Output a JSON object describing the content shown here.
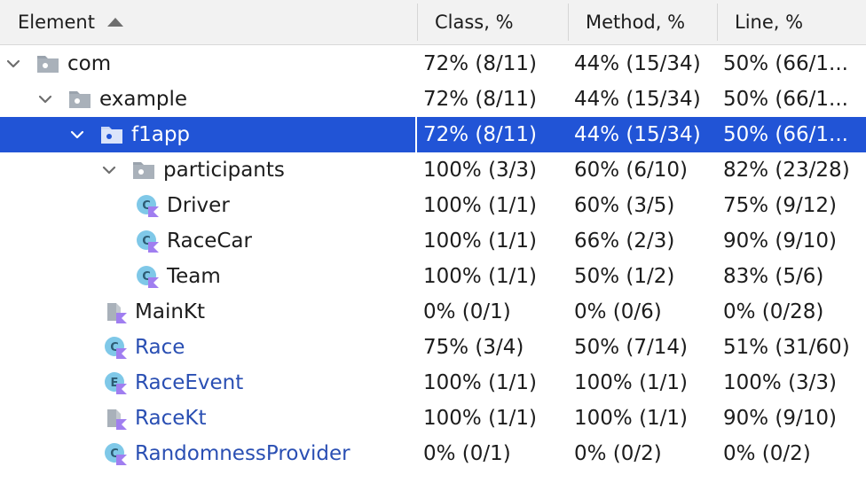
{
  "header": {
    "element": "Element",
    "class_pct": "Class, %",
    "method_pct": "Method, %",
    "line_pct": "Line, %"
  },
  "rows": [
    {
      "name": "com",
      "class": "72% (8/11)",
      "method": "44% (15/34)",
      "line": "50% (66/1...",
      "kind": "package",
      "depth": 0,
      "expanded": true,
      "selected": false,
      "link": false
    },
    {
      "name": "example",
      "class": "72% (8/11)",
      "method": "44% (15/34)",
      "line": "50% (66/1...",
      "kind": "package",
      "depth": 1,
      "expanded": true,
      "selected": false,
      "link": false
    },
    {
      "name": "f1app",
      "class": "72% (8/11)",
      "method": "44% (15/34)",
      "line": "50% (66/1...",
      "kind": "package",
      "depth": 2,
      "expanded": true,
      "selected": true,
      "link": false
    },
    {
      "name": "participants",
      "class": "100% (3/3)",
      "method": "60% (6/10)",
      "line": "82% (23/28)",
      "kind": "package",
      "depth": 3,
      "expanded": true,
      "selected": false,
      "link": false
    },
    {
      "name": "Driver",
      "class": "100% (1/1)",
      "method": "60% (3/5)",
      "line": "75% (9/12)",
      "kind": "kotlin-class",
      "depth": 4,
      "selected": false,
      "link": false
    },
    {
      "name": "RaceCar",
      "class": "100% (1/1)",
      "method": "66% (2/3)",
      "line": "90% (9/10)",
      "kind": "kotlin-class",
      "depth": 4,
      "selected": false,
      "link": false
    },
    {
      "name": "Team",
      "class": "100% (1/1)",
      "method": "50% (1/2)",
      "line": "83% (5/6)",
      "kind": "kotlin-class",
      "depth": 4,
      "selected": false,
      "link": false
    },
    {
      "name": "MainKt",
      "class": "0% (0/1)",
      "method": "0% (0/6)",
      "line": "0% (0/28)",
      "kind": "kotlin-file",
      "depth": 3,
      "selected": false,
      "link": false
    },
    {
      "name": "Race",
      "class": "75% (3/4)",
      "method": "50% (7/14)",
      "line": "51% (31/60)",
      "kind": "kotlin-class",
      "depth": 3,
      "selected": false,
      "link": true
    },
    {
      "name": "RaceEvent",
      "class": "100% (1/1)",
      "method": "100% (1/1)",
      "line": "100% (3/3)",
      "kind": "kotlin-enum",
      "depth": 3,
      "selected": false,
      "link": true
    },
    {
      "name": "RaceKt",
      "class": "100% (1/1)",
      "method": "100% (1/1)",
      "line": "90% (9/10)",
      "kind": "kotlin-file",
      "depth": 3,
      "selected": false,
      "link": true
    },
    {
      "name": "RandomnessProvider",
      "class": "0% (0/1)",
      "method": "0% (0/2)",
      "line": "0% (0/2)",
      "kind": "kotlin-class",
      "depth": 3,
      "selected": false,
      "link": true
    }
  ],
  "colors": {
    "selection": "#2154d6",
    "link": "#2a4fb3",
    "folder": "#9aa3ad",
    "class_badge": "#7fc8e8",
    "kotlin_mark": "#a07ef0"
  }
}
